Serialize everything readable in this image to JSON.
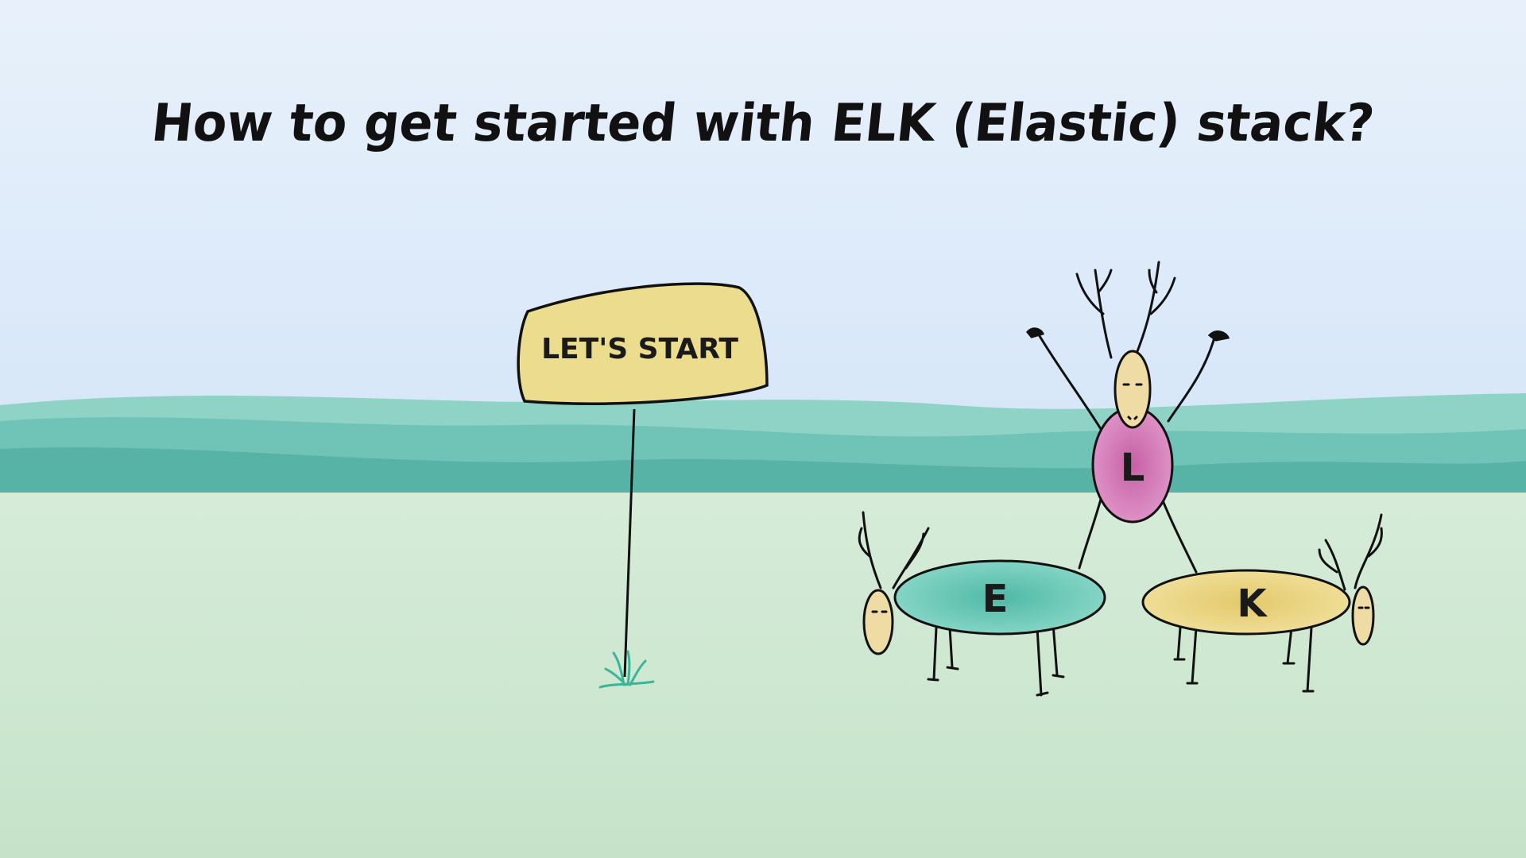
{
  "title": "How to get started with ELK (Elastic) stack?",
  "sign": {
    "label": "LET'S START"
  },
  "creatures": {
    "top": {
      "letter": "L",
      "color": "#d67fb6"
    },
    "left": {
      "letter": "E",
      "color": "#6ccdb8"
    },
    "right": {
      "letter": "K",
      "color": "#ecd77f"
    }
  },
  "colors": {
    "sky_top": "#e6f0fb",
    "sky_bottom": "#d6e6f8",
    "hills": "#5fbcb0",
    "ground": "#cfe8d2",
    "sign": "#ecdc8e",
    "grass": "#3ab59c"
  }
}
